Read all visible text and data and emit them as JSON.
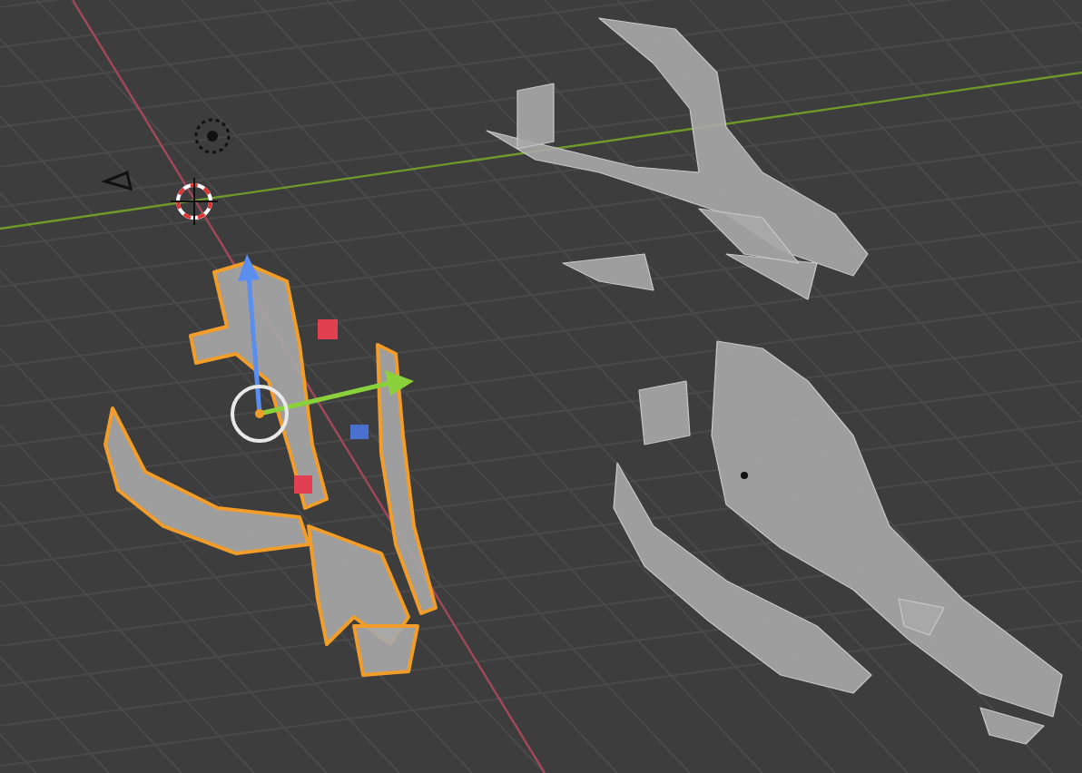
{
  "viewport": {
    "objects": [
      {
        "kind": "left",
        "selected": true
      },
      {
        "kind": "top",
        "selected": false
      },
      {
        "kind": "bottom",
        "selected": false
      }
    ]
  }
}
